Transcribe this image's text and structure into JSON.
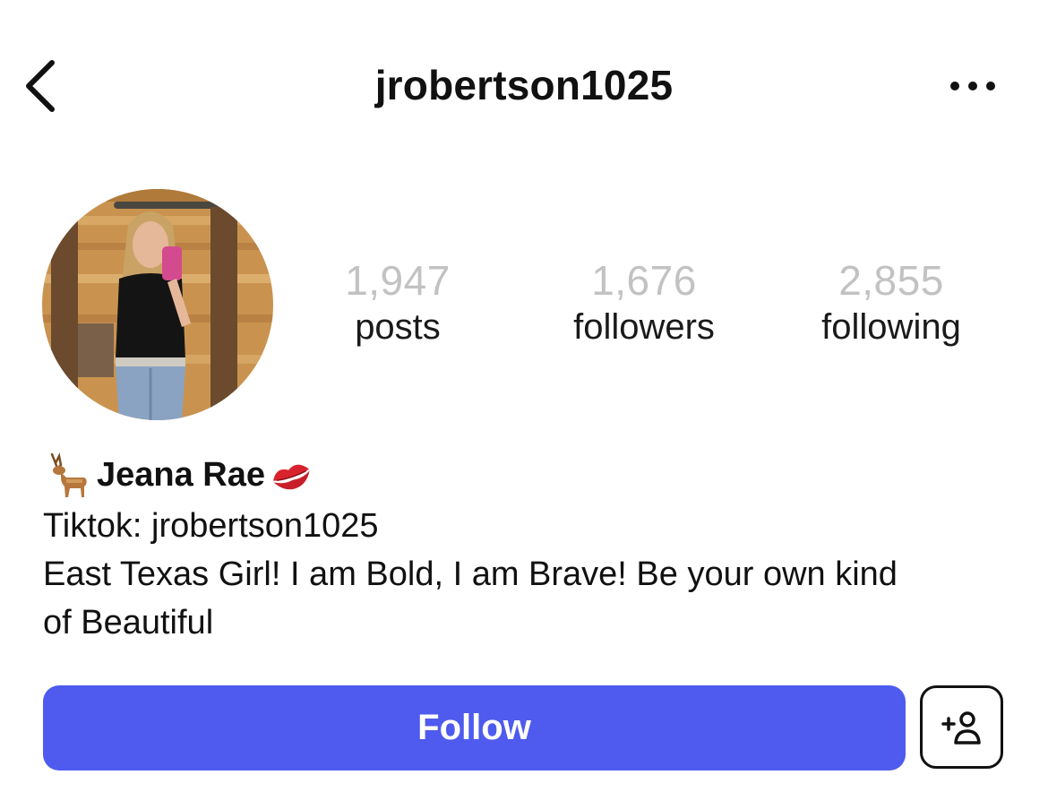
{
  "header": {
    "username": "jrobertson1025",
    "back_icon": "chevron-left-icon",
    "more_icon": "more-horizontal-icon"
  },
  "profile": {
    "avatar": "profile-photo",
    "stats": [
      {
        "value": "1,947",
        "label": "posts"
      },
      {
        "value": "1,676",
        "label": "followers"
      },
      {
        "value": "2,855",
        "label": "following"
      }
    ]
  },
  "bio": {
    "name": "Jeana Rae",
    "name_prefix_emoji": "deer-emoji",
    "name_suffix_emoji": "kiss-mark-emoji",
    "line1": "Tiktok: jrobertson1025",
    "line2": "East Texas Girl! I am Bold, I am Brave! Be your own kind",
    "line3": "of Beautiful"
  },
  "actions": {
    "follow_label": "Follow",
    "add_person_icon": "add-person-icon"
  },
  "colors": {
    "follow_button": "#4e5bee",
    "stat_number": "#c2c2c2"
  }
}
